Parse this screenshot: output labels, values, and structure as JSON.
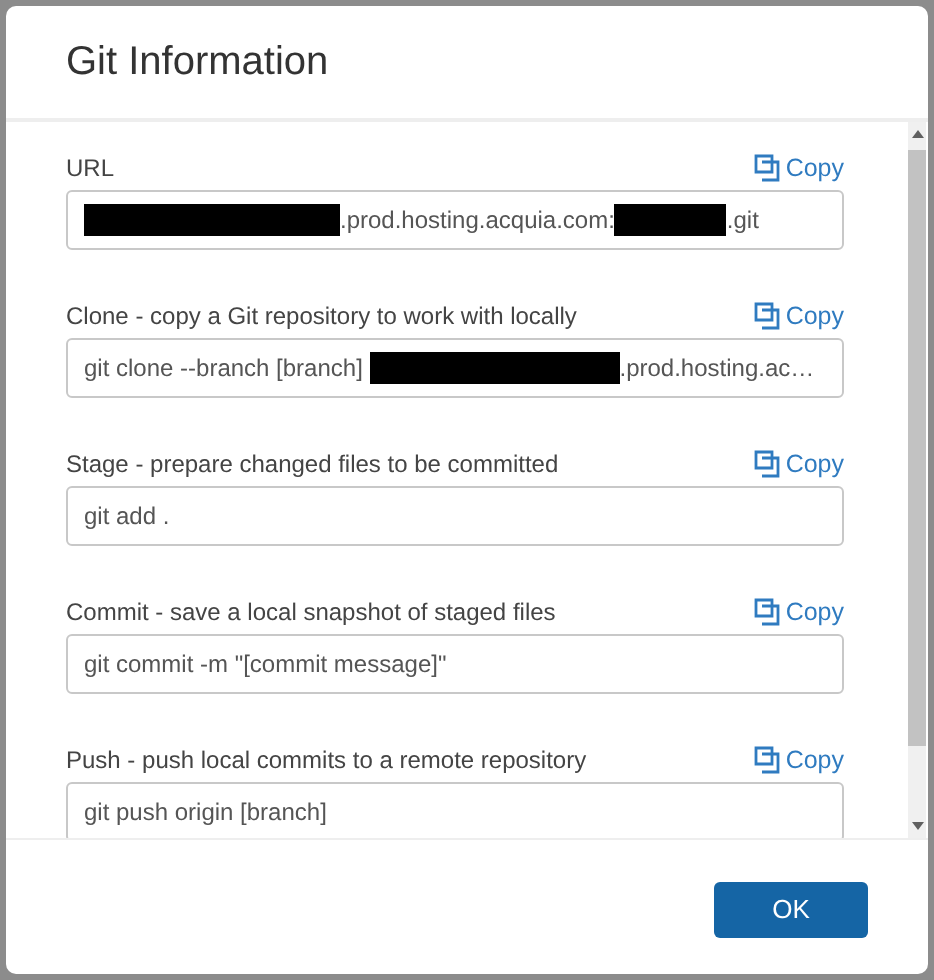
{
  "dialog": {
    "title": "Git Information"
  },
  "sections": [
    {
      "label": "URL",
      "copy": "Copy",
      "value": [
        {
          "kind": "redacted"
        },
        {
          "kind": "text",
          "text": ".prod.hosting.acquia.com:"
        },
        {
          "kind": "redacted"
        },
        {
          "kind": "text",
          "text": ".git"
        }
      ]
    },
    {
      "label": "Clone - copy a Git repository to work with locally",
      "copy": "Copy",
      "value": [
        {
          "kind": "text",
          "text": "git clone --branch [branch] "
        },
        {
          "kind": "redacted"
        },
        {
          "kind": "text",
          "text": ".prod.hosting.ac…"
        }
      ]
    },
    {
      "label": "Stage - prepare changed files to be committed",
      "copy": "Copy",
      "value": [
        {
          "kind": "text",
          "text": "git add ."
        }
      ]
    },
    {
      "label": "Commit - save a local snapshot of staged files",
      "copy": "Copy",
      "value": [
        {
          "kind": "text",
          "text": "git commit -m \"[commit message]\""
        }
      ]
    },
    {
      "label": "Push - push local commits to a remote repository",
      "copy": "Copy",
      "value": [
        {
          "kind": "text",
          "text": "git push origin [branch]"
        }
      ]
    }
  ],
  "buttons": [
    "OK"
  ]
}
